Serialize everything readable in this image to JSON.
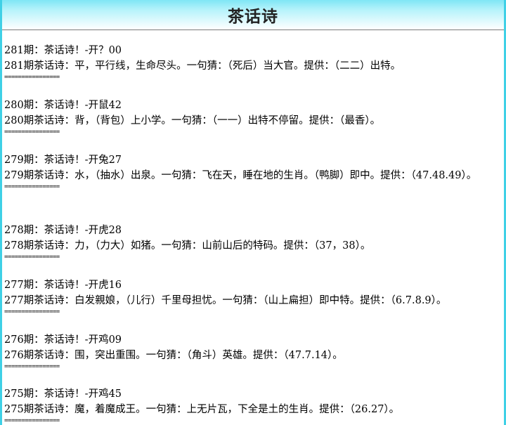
{
  "page": {
    "title": "茶话诗"
  },
  "entries": [
    {
      "heading": "281期：茶话诗！-开？00",
      "body": "281期茶话诗：平，平行线，生命尽头。一句猜：（死后）当大官。提供：（二二）出特。",
      "separator": "================"
    },
    {
      "heading": "280期：茶话诗！-开鼠42",
      "body": "280期茶话诗：背，（背包）上小学。一句猜：（一一）出特不停留。提供：（最香）。",
      "separator": "================"
    },
    {
      "heading": "279期：茶话诗！-开兔27",
      "body": "279期茶话诗：水，（抽水）出泉。一句猜：飞在天，睡在地的生肖。（鸭脚）即中。提供：（47.48.49）。",
      "separator": "================"
    },
    {
      "heading": "278期：茶话诗！-开虎28",
      "body": "278期茶话诗：力，（力大）如猪。一句猜：山前山后的特码。提供：（37，38）。",
      "separator": "================"
    },
    {
      "heading": "277期：茶话诗！-开虎16",
      "body": "277期茶话诗：白发親娘，（儿行）千里母担忧。一句猜：（山上扁担）即中特。提供：（6.7.8.9）。",
      "separator": "================"
    },
    {
      "heading": "276期：茶话诗！-开鸡09",
      "body": "276期茶话诗：围，突出重围。一句猜：（角斗）英雄。提供：（47.7.14）。",
      "separator": "================"
    },
    {
      "heading": "275期：茶话诗！-开鸡45",
      "body": "275期茶话诗：魔，着魔成王。一句猜：上无片瓦，下全是土的生肖。提供：（26.27）。",
      "separator": "================"
    }
  ]
}
